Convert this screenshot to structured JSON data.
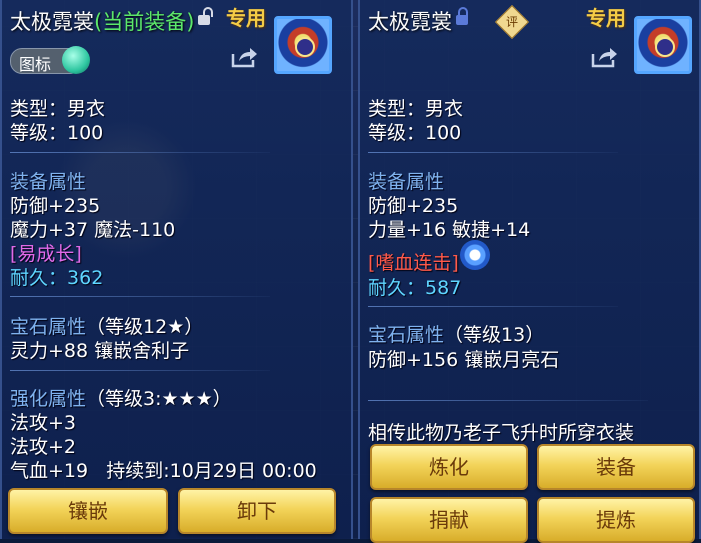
{
  "left": {
    "title": "太极霓裳",
    "title_status": "(当前装备)",
    "tag": "专用",
    "toggle_label": "图标",
    "type": "类型：男衣",
    "level": "等级：100",
    "section_equip": "装备属性",
    "defense": "防御+235",
    "magic": "魔力+37 魔法-110",
    "special": "[易成长]",
    "durability_label": "耐久：",
    "durability_value": "362",
    "section_gem": "宝石属性",
    "gem_level": "（等级12★）",
    "gem_stat": "灵力+88 镶嵌舍利子",
    "section_enhance": "强化属性",
    "enhance_level": "（等级3:★★★）",
    "enhance_1": "法攻+3",
    "enhance_2": "法攻+2",
    "enhance_3": "气血+19   持续到:10月29日 00:00",
    "buttons": [
      "镶嵌",
      "卸下"
    ]
  },
  "right": {
    "title": "太极霓裳",
    "tag": "专用",
    "eval_badge": "评",
    "type": "类型：男衣",
    "level": "等级：100",
    "section_equip": "装备属性",
    "defense": "防御+235",
    "strength": "力量+16 敏捷+14",
    "special": "[嗜血连击]",
    "durability_label": "耐久：",
    "durability_value": "587",
    "section_gem": "宝石属性",
    "gem_level": "（等级13）",
    "gem_stat": "防御+156 镶嵌月亮石",
    "description": "相传此物乃老子飞升时所穿衣装",
    "buttons": [
      "炼化",
      "装备",
      "捐献",
      "提炼"
    ]
  }
}
